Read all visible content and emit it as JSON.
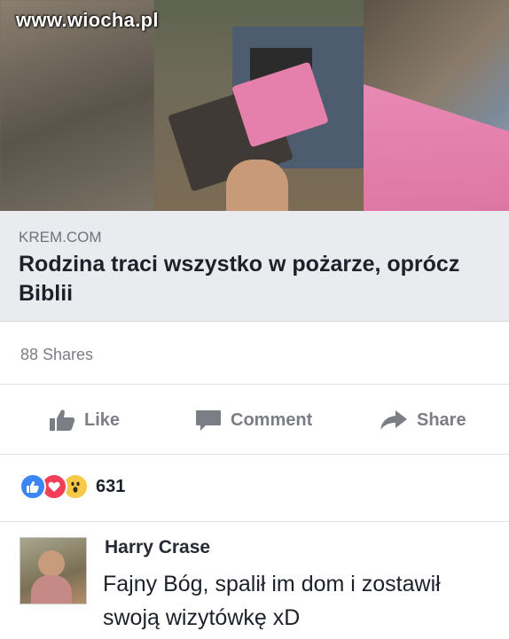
{
  "watermark": "www.wiocha.pl",
  "link": {
    "source": "KREM.COM",
    "title": "Rodzina traci wszystko w pożarze, oprócz Biblii"
  },
  "shares": "88 Shares",
  "actions": {
    "like": "Like",
    "comment": "Comment",
    "share": "Share"
  },
  "reactions": {
    "types": [
      "like",
      "love",
      "wow"
    ],
    "count": "631"
  },
  "comment": {
    "author": "Harry Crase",
    "text": "Fajny Bóg, spalił im dom i zostawił swoją wizytówkę xD"
  },
  "colors": {
    "link_box_bg": "#e9ebee",
    "action_gray": "#7b7e84",
    "like_blue": "#3b86f5",
    "love_red": "#f23e56",
    "wow_yellow": "#f7c94a"
  }
}
